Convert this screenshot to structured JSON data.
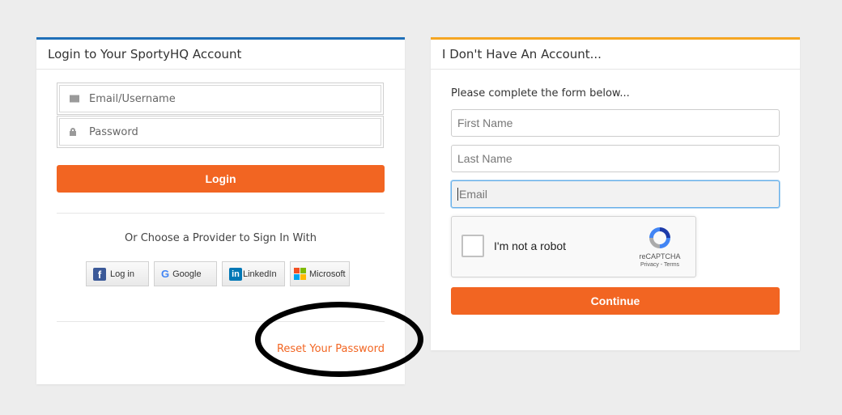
{
  "login": {
    "title": "Login to Your SportyHQ Account",
    "email_placeholder": "Email/Username",
    "password_placeholder": "Password",
    "login_button": "Login",
    "provider_text": "Or Choose a Provider to Sign In With",
    "providers": {
      "facebook": "Log in",
      "google": "Google",
      "linkedin": "LinkedIn",
      "microsoft": "Microsoft"
    },
    "reset_link": "Reset Your Password"
  },
  "register": {
    "title": "I Don't Have An Account...",
    "intro": "Please complete the form below...",
    "first_name_placeholder": "First Name",
    "last_name_placeholder": "Last Name",
    "email_placeholder": "Email",
    "captcha": {
      "label": "I'm not a robot",
      "brand": "reCAPTCHA",
      "links": "Privacy - Terms"
    },
    "continue_button": "Continue"
  },
  "colors": {
    "accent": "#f26522",
    "login_panel_border": "#1f6fb8",
    "register_panel_border": "#f5a623"
  }
}
